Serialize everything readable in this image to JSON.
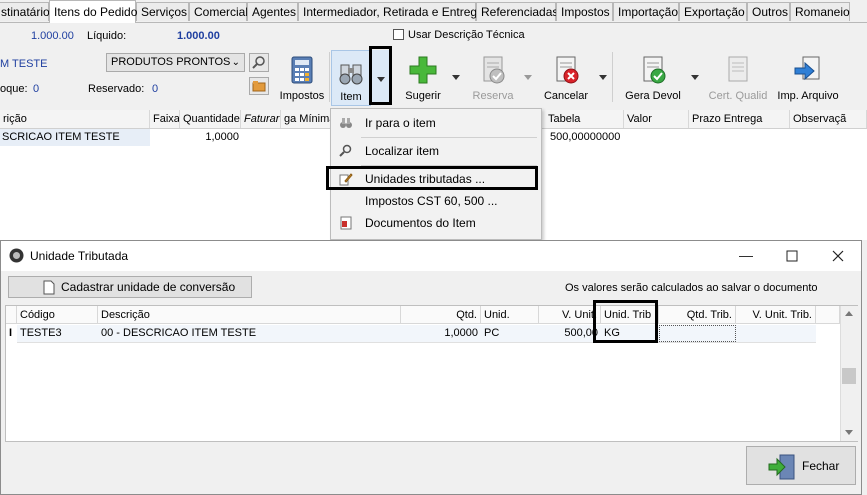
{
  "tabs": [
    "stinatário",
    "Itens do Pedido",
    "Serviços",
    "Comercial",
    "Agentes",
    "Intermediador, Retirada e Entrega",
    "Referenciadas",
    "Impostos",
    "Importação",
    "Exportação",
    "Outros",
    "Romaneio"
  ],
  "header": {
    "total_value": "1.000.00",
    "liquido_label": "Líquido:",
    "liquido_value": "1.000.00",
    "usar_descricao_label": "Usar Descrição Técnica",
    "item_name": "M TESTE",
    "produtos_combo": "PRODUTOS PRONTOS",
    "estoque_label": "oque:",
    "estoque_value": "0",
    "reservado_label": "Reservado:",
    "reservado_value": "0"
  },
  "toolbar": {
    "impostos": "Impostos",
    "item": "Item",
    "sugerir": "Sugerir",
    "reserva": "Reserva",
    "cancelar": "Cancelar",
    "gera_devol": "Gera Devol",
    "cert_qualid": "Cert. Qualid",
    "imp_arquivo": "Imp. Arquivo"
  },
  "grid": {
    "headers": [
      "rição",
      "Faixa",
      "Quantidade",
      "Faturar",
      "ga Mínima",
      "Tabela",
      "Valor",
      "Prazo Entrega",
      "Observaçã"
    ],
    "row": {
      "descricao": "SCRICAO ITEM TESTE",
      "quantidade": "1,0000",
      "tabela": "500,00000000"
    }
  },
  "context_menu": {
    "items": [
      "Ir para o item",
      "Localizar item",
      "Unidades tributadas ...",
      "Impostos CST 60, 500 ...",
      "Documentos do Item"
    ]
  },
  "dialog": {
    "title": "Unidade Tributada",
    "cadastrar_button": "Cadastrar unidade de conversão",
    "info_text": "Os valores serão calculados ao salvar o documento",
    "columns": [
      "Código",
      "Descrição",
      "Qtd.",
      "Unid.",
      "V. Unit.",
      "Unid. Trib",
      "Qtd. Trib.",
      "V. Unit. Trib."
    ],
    "row": {
      "codigo": "TESTE3",
      "descricao": "00 - DESCRICAO ITEM TESTE",
      "qtd": "1,0000",
      "unid": "PC",
      "v_unit": "500,00",
      "unid_trib": "KG",
      "qtd_trib": "",
      "v_unit_trib": ""
    },
    "fechar_button": "Fechar"
  }
}
